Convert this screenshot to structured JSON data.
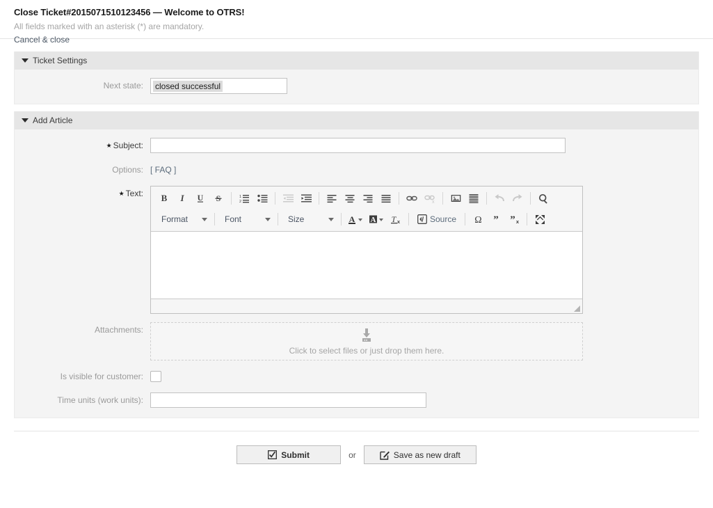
{
  "header": {
    "title": "Close Ticket#2015071510123456 — Welcome to OTRS!",
    "subtitle": "All fields marked with an asterisk (*) are mandatory.",
    "cancel_label": "Cancel & close"
  },
  "ticket_settings": {
    "section_title": "Ticket Settings",
    "next_state_label": "Next state:",
    "next_state_value": "closed successful"
  },
  "add_article": {
    "section_title": "Add Article",
    "subject_label": "Subject:",
    "subject_value": "",
    "options_label": "Options:",
    "faq_link": "[ FAQ ]",
    "text_label": "Text:",
    "text_value": "",
    "attachments_label": "Attachments:",
    "dropzone_text": "Click to select files or just drop them here.",
    "visible_label": "Is visible for customer:",
    "visible_checked": false,
    "time_units_label": "Time units (work units):",
    "time_units_value": ""
  },
  "editor_toolbar": {
    "row1": [
      {
        "name": "bold-icon",
        "title": "Bold",
        "disabled": false
      },
      {
        "name": "italic-icon",
        "title": "Italic",
        "disabled": false
      },
      {
        "name": "underline-icon",
        "title": "Underline",
        "disabled": false
      },
      {
        "name": "strikethrough-icon",
        "title": "Strike Through",
        "disabled": false
      },
      {
        "name": "numbered-list-icon",
        "title": "Insert/Remove Numbered List",
        "disabled": false
      },
      {
        "name": "bulleted-list-icon",
        "title": "Insert/Remove Bulleted List",
        "disabled": false
      },
      {
        "name": "outdent-icon",
        "title": "Decrease Indent",
        "disabled": true
      },
      {
        "name": "indent-icon",
        "title": "Increase Indent",
        "disabled": false
      },
      {
        "name": "align-left-icon",
        "title": "Align Left",
        "disabled": false
      },
      {
        "name": "align-center-icon",
        "title": "Center",
        "disabled": false
      },
      {
        "name": "align-right-icon",
        "title": "Align Right",
        "disabled": false
      },
      {
        "name": "justify-icon",
        "title": "Justify",
        "disabled": false
      },
      {
        "name": "link-icon",
        "title": "Link",
        "disabled": false
      },
      {
        "name": "unlink-icon",
        "title": "Unlink",
        "disabled": true
      },
      {
        "name": "image-icon",
        "title": "Image",
        "disabled": false
      },
      {
        "name": "horizontal-rule-icon",
        "title": "Insert Horizontal Line",
        "disabled": false
      },
      {
        "name": "undo-icon",
        "title": "Undo",
        "disabled": true
      },
      {
        "name": "redo-icon",
        "title": "Redo",
        "disabled": true
      },
      {
        "name": "find-icon",
        "title": "Find",
        "disabled": false
      }
    ],
    "format_label": "Format",
    "font_label": "Font",
    "size_label": "Size",
    "source_label": "Source",
    "row2_icons": [
      {
        "name": "text-color-icon",
        "title": "Text Color"
      },
      {
        "name": "background-color-icon",
        "title": "Background Color"
      },
      {
        "name": "remove-format-icon",
        "title": "Remove Format"
      },
      {
        "name": "special-character-icon",
        "title": "Insert Special Character"
      },
      {
        "name": "blockquote-icon",
        "title": "Block Quote"
      },
      {
        "name": "remove-quote-icon",
        "title": "Remove Quote"
      },
      {
        "name": "maximize-icon",
        "title": "Maximize"
      }
    ]
  },
  "footer": {
    "submit_label": "Submit",
    "or_label": "or",
    "draft_label": "Save as new draft"
  }
}
